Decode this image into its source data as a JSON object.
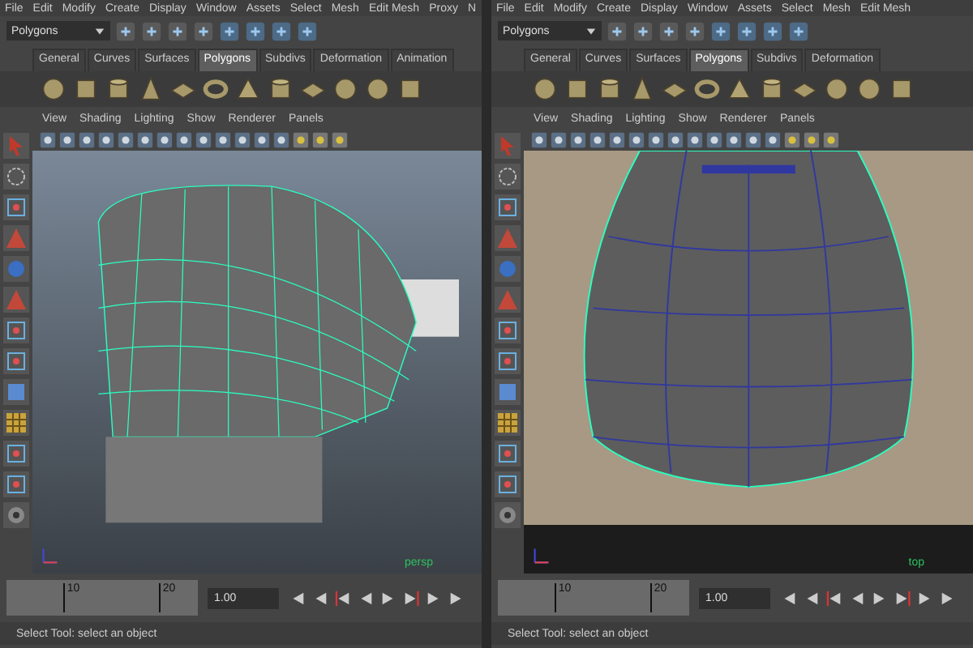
{
  "panes": [
    {
      "menus": [
        "File",
        "Edit",
        "Modify",
        "Create",
        "Display",
        "Window",
        "Assets",
        "Select",
        "Mesh",
        "Edit Mesh",
        "Proxy",
        "N"
      ],
      "mode": "Polygons",
      "shelf_tabs": [
        {
          "label": "General",
          "selected": false
        },
        {
          "label": "Curves",
          "selected": false
        },
        {
          "label": "Surfaces",
          "selected": false
        },
        {
          "label": "Polygons",
          "selected": true
        },
        {
          "label": "Subdivs",
          "selected": false
        },
        {
          "label": "Deformation",
          "selected": false
        },
        {
          "label": "Animation",
          "selected": false
        }
      ],
      "panel_menus": [
        "View",
        "Shading",
        "Lighting",
        "Show",
        "Renderer",
        "Panels"
      ],
      "kind": "perspective",
      "camera": "persp",
      "ticks": [
        "10",
        "20"
      ],
      "current_frame": "1.00",
      "status": "Select Tool: select an object"
    },
    {
      "menus": [
        "File",
        "Edit",
        "Modify",
        "Create",
        "Display",
        "Window",
        "Assets",
        "Select",
        "Mesh",
        "Edit Mesh"
      ],
      "mode": "Polygons",
      "shelf_tabs": [
        {
          "label": "General",
          "selected": false
        },
        {
          "label": "Curves",
          "selected": false
        },
        {
          "label": "Surfaces",
          "selected": false
        },
        {
          "label": "Polygons",
          "selected": true
        },
        {
          "label": "Subdivs",
          "selected": false
        },
        {
          "label": "Deformation",
          "selected": false
        }
      ],
      "panel_menus": [
        "View",
        "Shading",
        "Lighting",
        "Show",
        "Renderer",
        "Panels"
      ],
      "kind": "top",
      "camera": "top",
      "ticks": [
        "10",
        "20"
      ],
      "current_frame": "1.00",
      "status": "Select Tool: select an object"
    }
  ]
}
